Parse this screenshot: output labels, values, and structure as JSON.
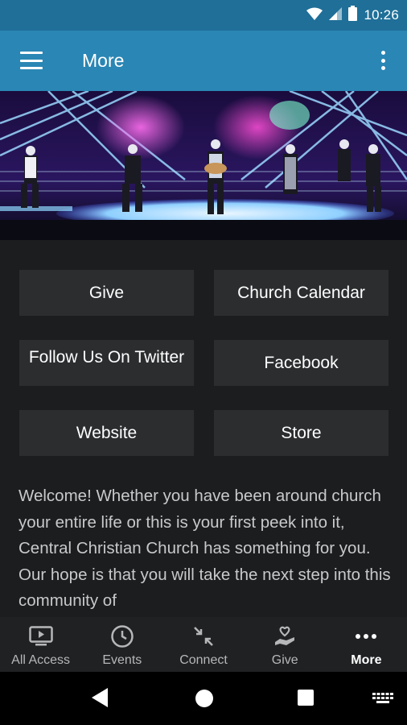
{
  "status_bar": {
    "time": "10:26",
    "icons": [
      "wifi-icon",
      "signal-icon",
      "battery-icon"
    ]
  },
  "app_bar": {
    "title": "More",
    "menu_icon": "hamburger-menu-icon",
    "overflow_icon": "overflow-menu-icon"
  },
  "hero": {
    "image": "worship-band-on-stage-photo"
  },
  "buttons": {
    "give": "Give",
    "church_calendar": "Church Calendar",
    "follow_twitter": "Follow Us On Twitter",
    "facebook": "Facebook",
    "website": "Website",
    "store": "Store"
  },
  "welcome_text": "Welcome! Whether you have been around church your entire life or this is your first peek into it, Central Christian Church has something for you. Our hope is that you will take the next step into this community of",
  "tabs": [
    {
      "label": "All Access",
      "icon": "tv-icon",
      "active": false
    },
    {
      "label": "Events",
      "icon": "clock-icon",
      "active": false
    },
    {
      "label": "Connect",
      "icon": "connect-arrows-icon",
      "active": false
    },
    {
      "label": "Give",
      "icon": "hand-heart-icon",
      "active": false
    },
    {
      "label": "More",
      "icon": "more-dots-icon",
      "active": true
    }
  ],
  "colors": {
    "status_bar": "#1f6f98",
    "app_bar": "#2a86b4",
    "background": "#1b1d1f",
    "button": "#2b2d2f",
    "tab_bar": "#1f2123"
  }
}
